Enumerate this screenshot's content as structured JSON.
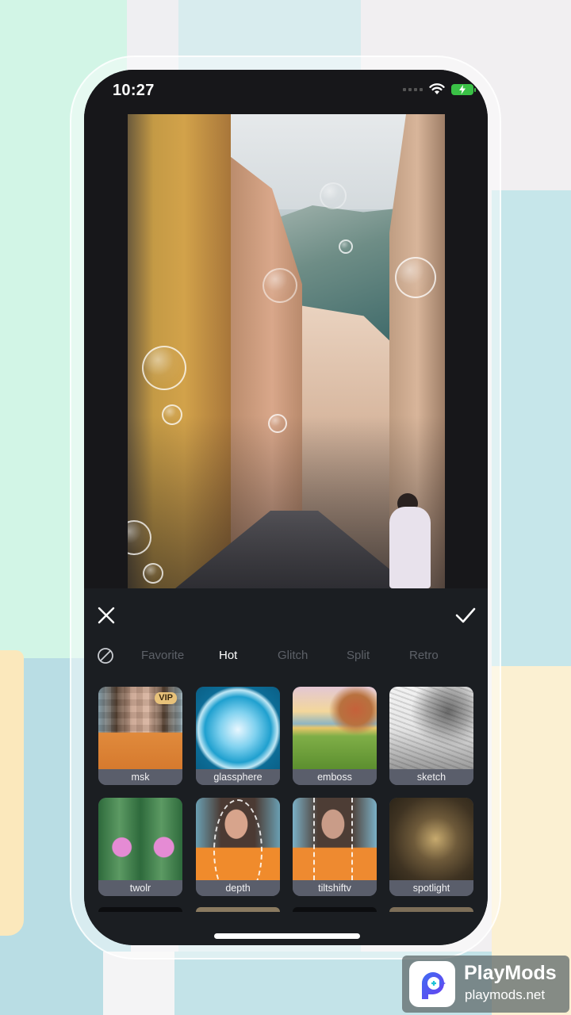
{
  "status_bar": {
    "time": "10:27",
    "icons": [
      "cellular-signal-icon",
      "wifi-icon",
      "battery-charging-icon"
    ],
    "battery_color": "#3ac146"
  },
  "editor": {
    "toolbar": {
      "close_icon": "close-icon",
      "confirm_icon": "checkmark-icon"
    },
    "tabs": {
      "none_icon": "no-effect-icon",
      "items": [
        {
          "label": "Favorite",
          "active": false
        },
        {
          "label": "Hot",
          "active": true
        },
        {
          "label": "Glitch",
          "active": false
        },
        {
          "label": "Split",
          "active": false
        },
        {
          "label": "Retro",
          "active": false
        }
      ]
    },
    "effects": [
      {
        "label": "msk",
        "badge": "VIP"
      },
      {
        "label": "glassphere",
        "badge": ""
      },
      {
        "label": "emboss",
        "badge": ""
      },
      {
        "label": "sketch",
        "badge": ""
      },
      {
        "label": "twolr",
        "badge": ""
      },
      {
        "label": "depth",
        "badge": ""
      },
      {
        "label": "tiltshiftv",
        "badge": ""
      },
      {
        "label": "spotlight",
        "badge": ""
      }
    ]
  },
  "watermark": {
    "title": "PlayMods",
    "url": "playmods.net"
  },
  "colors": {
    "panel_bg": "#1b1e22",
    "tab_active": "#ffffff",
    "tab_inactive": "#5d6168",
    "vip_badge": "#e8c27a",
    "label_bg": "#5a5e6b"
  }
}
